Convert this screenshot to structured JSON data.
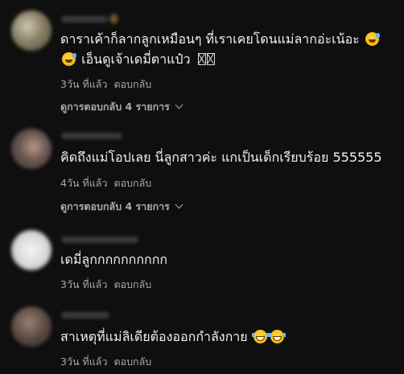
{
  "comments": [
    {
      "text_line1": "ดาราเค้าก็ลากลูกเหมือนๆ ที่เราเคยโดนแม่ลากอ่ะเน้อะ",
      "text_line2": "เอ็นดูเจ้าเดมี่ตาแป๋ว",
      "emoji": [
        "sweat-smile-icon",
        "sweat-smile-icon"
      ],
      "time": "3วัน ที่แล้ว",
      "reply_label": "ตอบกลับ",
      "replies_label": "ดูการตอบกลับ 4 รายการ"
    },
    {
      "text_line1": "คิดถึงแม่โอปเลย นี่ลูกสาวค่ะ แกเป็นเด็กเรียบร้อย 555555",
      "time": "4วัน ที่แล้ว",
      "reply_label": "ตอบกลับ",
      "replies_label": "ดูการตอบกลับ 4 รายการ"
    },
    {
      "text_line1": "เดมี่ลูกกกกกกกกกก",
      "time": "3วัน ที่แล้ว",
      "reply_label": "ตอบกลับ"
    },
    {
      "text_line1": "สาเหตุที่แม่ลิเดียต้องออกกำลังกาย",
      "emoji": [
        "tears-of-joy-icon",
        "tears-of-joy-icon"
      ],
      "time": "3วัน ที่แล้ว",
      "reply_label": "ตอบกลับ"
    }
  ]
}
